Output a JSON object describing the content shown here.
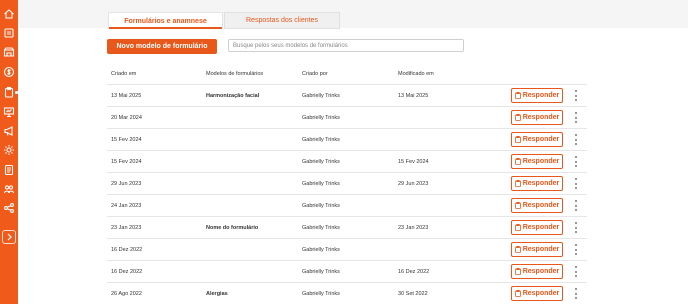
{
  "sidebar": {
    "icons": [
      "home-icon",
      "catalog-icon",
      "store-icon",
      "dollar-icon",
      "clipboard-icon",
      "presentation-icon",
      "megaphone-icon",
      "settings-icon",
      "document-list-icon",
      "group-icon",
      "share-icon"
    ],
    "expand_icon": "chevron-right-icon",
    "color": "#f05a1a"
  },
  "tabs": [
    {
      "label": "Formulários e anamnese",
      "active": true
    },
    {
      "label": "Respostas dos clientes",
      "active": false
    }
  ],
  "toolbar": {
    "new_button_label": "Novo modelo de formulário",
    "search_placeholder": "Busque pelos seus modelos de formulários"
  },
  "table": {
    "headers": {
      "created": "Criado em",
      "model": "Modelos de formulários",
      "by": "Criado por",
      "modified": "Modificado em"
    },
    "respond_label": "Responder",
    "rows": [
      {
        "created": "13 Mai 2025",
        "model": "Harmonização facial",
        "by": "Gabrielly Trinks",
        "modified": "13 Mai 2025"
      },
      {
        "created": "20 Mar 2024",
        "model": "",
        "by": "Gabrielly Trinks",
        "modified": ""
      },
      {
        "created": "15 Fev 2024",
        "model": "",
        "by": "Gabrielly Trinks",
        "modified": ""
      },
      {
        "created": "15 Fev 2024",
        "model": "",
        "by": "Gabrielly Trinks",
        "modified": "15 Fev 2024"
      },
      {
        "created": "29 Jun 2023",
        "model": "",
        "by": "Gabrielly Trinks",
        "modified": "29 Jun 2023"
      },
      {
        "created": "24 Jan 2023",
        "model": "",
        "by": "Gabrielly Trinks",
        "modified": ""
      },
      {
        "created": "23 Jan 2023",
        "model": "Nome do formulário",
        "by": "Gabrielly Trinks",
        "modified": "23 Jan 2023"
      },
      {
        "created": "16 Dez 2022",
        "model": "",
        "by": "Gabrielly Trinks",
        "modified": ""
      },
      {
        "created": "16 Dez 2022",
        "model": "",
        "by": "Gabrielly Trinks",
        "modified": "16 Dez 2022"
      },
      {
        "created": "26 Ago 2022",
        "model": "Alergias",
        "by": "Gabrielly Trinks",
        "modified": "30 Set 2022"
      }
    ]
  },
  "colors": {
    "accent": "#e8581a",
    "sidebar": "#f05a1a"
  }
}
